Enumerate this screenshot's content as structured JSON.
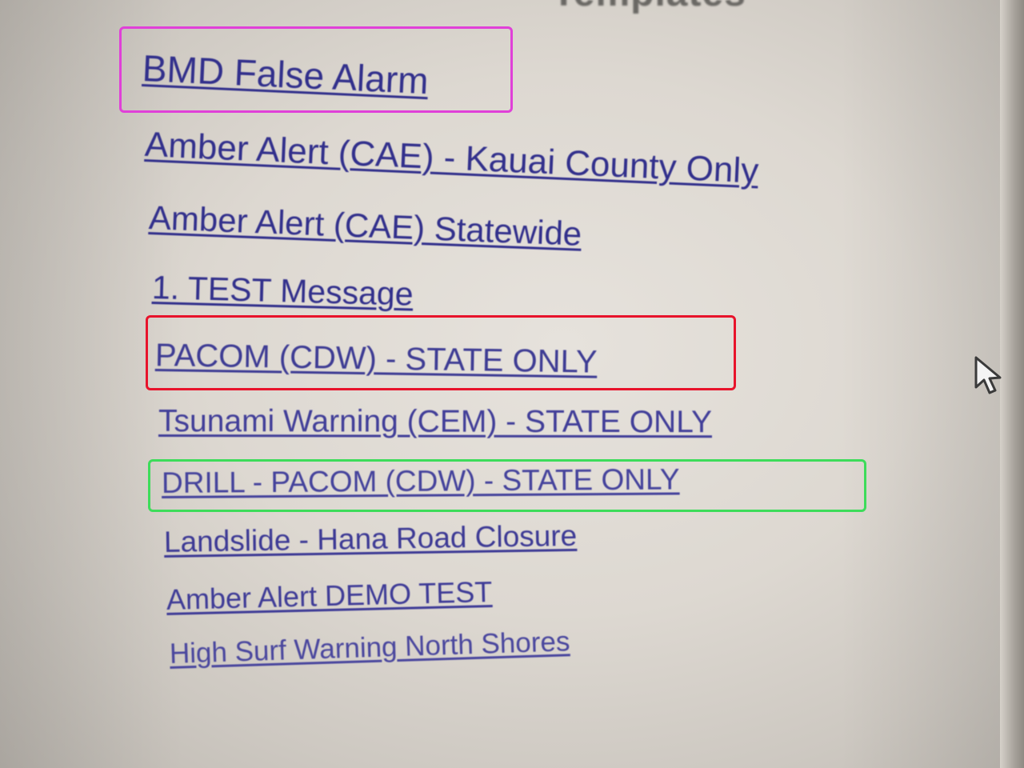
{
  "section": {
    "heading_fragment": "Templates"
  },
  "templates": [
    {
      "label": "BMD False Alarm"
    },
    {
      "label": "Amber Alert (CAE) - Kauai County Only"
    },
    {
      "label": "Amber Alert (CAE) Statewide"
    },
    {
      "label": "1. TEST Message"
    },
    {
      "label": "PACOM (CDW) - STATE ONLY"
    },
    {
      "label": "Tsunami Warning (CEM) - STATE ONLY"
    },
    {
      "label": "DRILL - PACOM (CDW) - STATE ONLY"
    },
    {
      "label": "Landslide - Hana Road Closure"
    },
    {
      "label": "Amber Alert DEMO TEST"
    },
    {
      "label": "High Surf Warning North Shores"
    }
  ],
  "annotations": {
    "magenta_box_color": "#e040d8",
    "red_box_color": "#e8132b",
    "green_box_color": "#3ddc5a"
  },
  "colors": {
    "link": "#32308c",
    "background": "#e0dcd5"
  },
  "cursor": {
    "icon": "arrow-pointer-icon"
  }
}
